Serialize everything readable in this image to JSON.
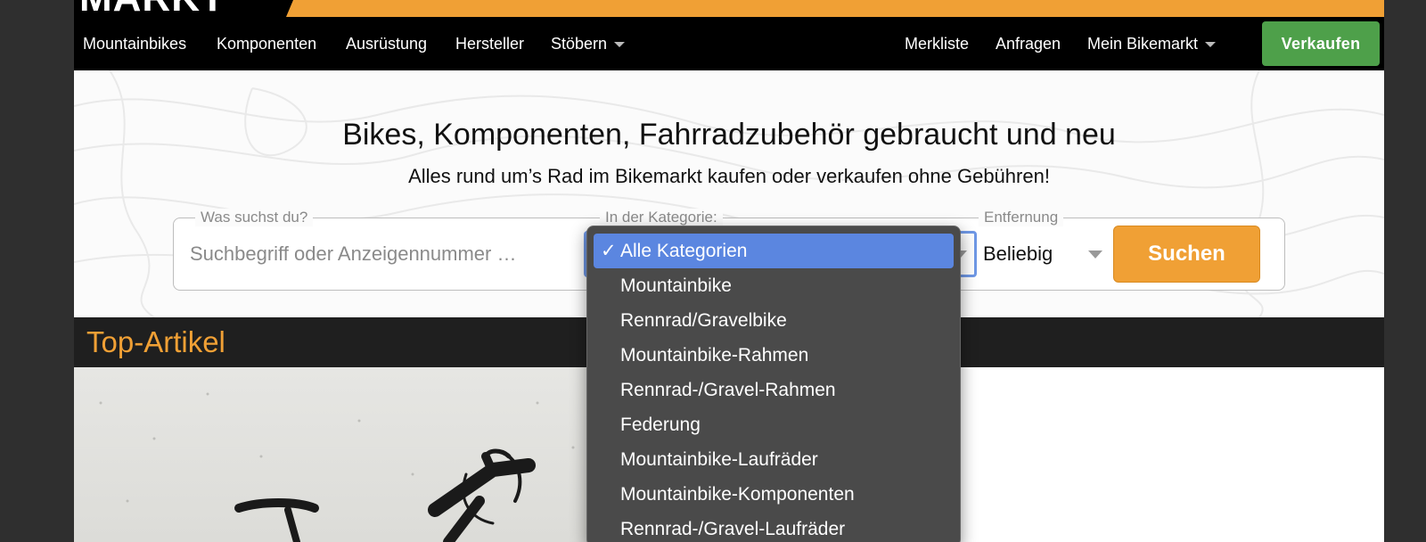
{
  "logo": {
    "text": "MARKT"
  },
  "nav": {
    "left": [
      {
        "label": "Mountainbikes"
      },
      {
        "label": "Komponenten"
      },
      {
        "label": "Ausrüstung"
      },
      {
        "label": "Hersteller"
      },
      {
        "label": "Stöbern"
      }
    ],
    "right": [
      {
        "label": "Merkliste"
      },
      {
        "label": "Anfragen"
      },
      {
        "label": "Mein Bikemarkt"
      }
    ],
    "sell_label": "Verkaufen"
  },
  "hero": {
    "title": "Bikes, Komponenten, Fahrradzubehör gebraucht und neu",
    "subtitle": "Alles rund um’s Rad im Bikemarkt kaufen oder verkaufen ohne Gebühren!"
  },
  "search": {
    "query_legend": "Was suchst du?",
    "query_placeholder": "Suchbegriff oder Anzeigennummer …",
    "query_value": "",
    "category_legend": "In der Kategorie:",
    "distance_legend": "Entfernung",
    "distance_value": "Beliebig",
    "button_label": "Suchen"
  },
  "top_articles": {
    "title": "Top-Artikel"
  },
  "category_dropdown": {
    "selected": "Alle Kategorien",
    "check": "✓",
    "options": [
      "Mountainbike",
      "Rennrad/Gravelbike",
      "Mountainbike-Rahmen",
      "Rennrad-/Gravel-Rahmen",
      "Federung",
      "Mountainbike-Laufräder",
      "Mountainbike-Komponenten",
      "Rennrad-/Gravel-Laufräder"
    ]
  },
  "colors": {
    "accent_orange": "#f0a035",
    "sell_green": "#4ea04a",
    "selection_blue": "#5b86e0",
    "nav_background": "#000000"
  }
}
